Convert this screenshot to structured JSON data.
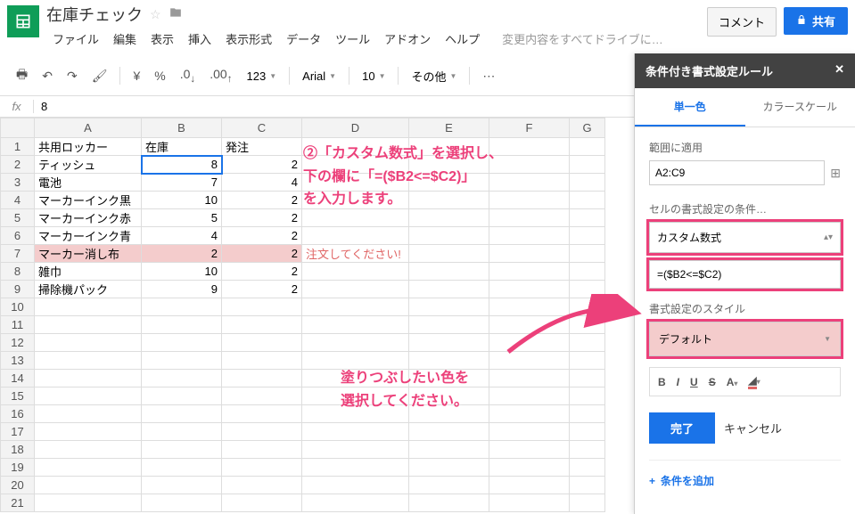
{
  "doc": {
    "title": "在庫チェック"
  },
  "menu": {
    "file": "ファイル",
    "edit": "編集",
    "view": "表示",
    "insert": "挿入",
    "format": "表示形式",
    "data": "データ",
    "tools": "ツール",
    "addons": "アドオン",
    "help": "ヘルプ",
    "save_state": "変更内容をすべてドライブに…"
  },
  "buttons": {
    "comment": "コメント",
    "share": "共有",
    "done": "完了",
    "cancel": "キャンセル"
  },
  "toolbar": {
    "currency": "¥",
    "percent": "%",
    "dec_dec": ".0",
    "dec_inc": ".00",
    "num_fmt": "123",
    "font": "Arial",
    "size": "10",
    "more": "その他"
  },
  "formula": {
    "fx": "fx",
    "value": "8"
  },
  "cols": [
    "A",
    "B",
    "C",
    "D",
    "E",
    "F",
    "G"
  ],
  "rows": [
    {
      "r": "1",
      "A": "共用ロッカー",
      "B": "在庫",
      "C": "発注",
      "D": "",
      "hl": false
    },
    {
      "r": "2",
      "A": "ティッシュ",
      "B": "8",
      "C": "2",
      "D": "",
      "hl": false,
      "sel": true
    },
    {
      "r": "3",
      "A": "電池",
      "B": "7",
      "C": "4",
      "D": "",
      "hl": false
    },
    {
      "r": "4",
      "A": "マーカーインク黒",
      "B": "10",
      "C": "2",
      "D": "",
      "hl": false
    },
    {
      "r": "5",
      "A": "マーカーインク赤",
      "B": "5",
      "C": "2",
      "D": "",
      "hl": false
    },
    {
      "r": "6",
      "A": "マーカーインク青",
      "B": "4",
      "C": "2",
      "D": "",
      "hl": false
    },
    {
      "r": "7",
      "A": "マーカー消し布",
      "B": "2",
      "C": "2",
      "D": "注文してください!",
      "hl": true
    },
    {
      "r": "8",
      "A": "雑巾",
      "B": "10",
      "C": "2",
      "D": "",
      "hl": false
    },
    {
      "r": "9",
      "A": "掃除機パック",
      "B": "9",
      "C": "2",
      "D": "",
      "hl": false
    },
    {
      "r": "10"
    },
    {
      "r": "11"
    },
    {
      "r": "12"
    },
    {
      "r": "13"
    },
    {
      "r": "14"
    },
    {
      "r": "15"
    },
    {
      "r": "16"
    },
    {
      "r": "17"
    },
    {
      "r": "18"
    },
    {
      "r": "19"
    },
    {
      "r": "20"
    },
    {
      "r": "21"
    }
  ],
  "sidebar": {
    "title": "条件付き書式設定ルール",
    "tab_single": "単一色",
    "tab_scale": "カラースケール",
    "range_label": "範囲に適用",
    "range": "A2:C9",
    "cond_label": "セルの書式設定の条件…",
    "cond_type": "カスタム数式",
    "formula": "=($B2<=$C2)",
    "style_label": "書式設定のスタイル",
    "style_preview": "デフォルト",
    "add_rule": "条件を追加"
  },
  "annotations": {
    "a1_l1": "②「カスタム数式」を選択し、",
    "a1_l2": "下の欄に「=($B2<=$C2)」",
    "a1_l3": "を入力します。",
    "a2_l1": "塗りつぶしたい色を",
    "a2_l2": "選択してください。"
  }
}
